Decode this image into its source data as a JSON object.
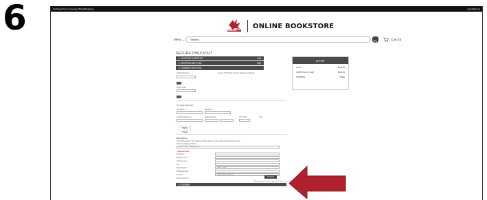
{
  "step_number": "6",
  "top_bar": {
    "left_text": "Southeast Penn University Official Bookstore",
    "right_text": "Login/Sign Up"
  },
  "header": {
    "logo_text": "SHEBEEN",
    "title": "ONLINE BOOKSTORE"
  },
  "nav": {
    "menu_label": "Menu",
    "search_placeholder": "Search",
    "cart_label": "Cart (0)"
  },
  "checkout": {
    "heading": "SECURE CHECKOUT",
    "sections": [
      {
        "label": "1. SHIPPING ADDRESS",
        "action": "Edit"
      },
      {
        "label": "2. SHIPPING METHOD",
        "action": "Edit"
      },
      {
        "label": "3. PAYMENT METHOD",
        "action": ""
      }
    ],
    "review_label": "4. REVIEW"
  },
  "payment": {
    "gift_card_label": "Gift Card Number",
    "gift_card_note": "Receive 5% off your order by adding your gift card",
    "apply_label": "Apply",
    "promo_label": "Promo Code",
    "apply2_label": "Apply",
    "pay_with_card": "Pay with a Credit Card",
    "first_name": "First Name",
    "last_name": "Last Name",
    "card_number": "Credit Card Number",
    "expiration": "Expiration Date",
    "cvv": "CVV Code",
    "save": "Save",
    "paypal_label": "PayPal Credit",
    "billing_heading": "Billing Address",
    "billing_note": "Your billing address must match the billing address of the payment method for this order.",
    "same_as_shipping": "Same as shipping address",
    "select_address": "Select or enter a billing address",
    "required_note": "* Required Fields",
    "full_name": "Full Name *",
    "address1": "Address Line 1 *",
    "address2": "Address Line 2",
    "city": "City *",
    "state": "State/Province *",
    "state_value": "Select a State",
    "zip": "Zip/Postal Code *",
    "country": "Country *",
    "country_value": "United States of America",
    "phone": "Phone Number *",
    "continue_label": "Continue",
    "terms_note": "By placing your order you agree to our terms and conditions"
  },
  "cart": {
    "title": "CART",
    "rows": [
      {
        "label": "1 Item",
        "value": "$233.99"
      },
      {
        "label": "SUBTOTAL (1 ITEM)",
        "value": "$233.99"
      },
      {
        "label": "SHIPPING",
        "value": "FREE"
      }
    ]
  },
  "colors": {
    "header_bar": "#4a4a4a",
    "arrow": "#b0212e",
    "accent_red": "#b00000"
  }
}
